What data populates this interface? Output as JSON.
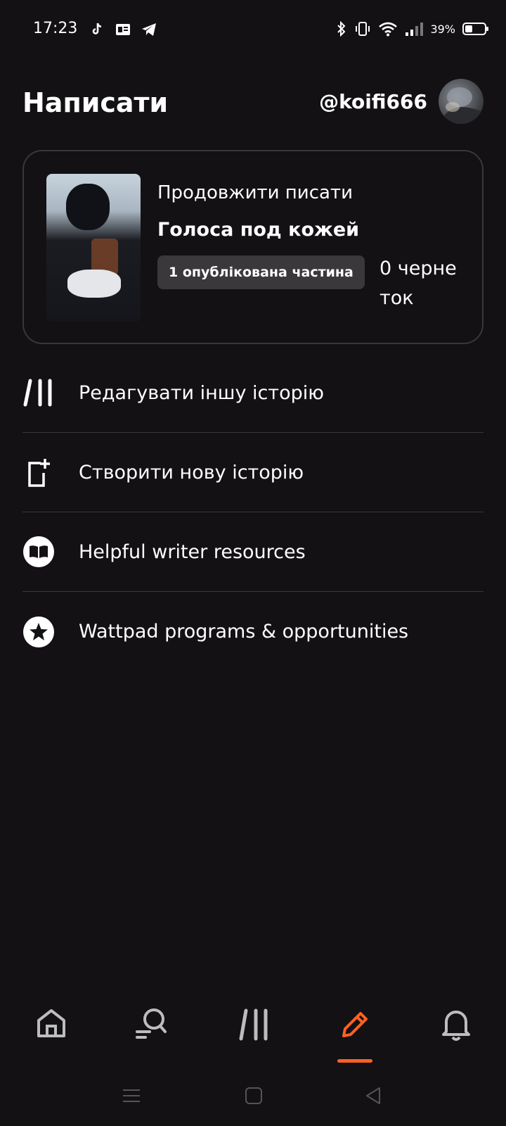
{
  "status_bar": {
    "time": "17:23",
    "battery_percent": "39%",
    "left_icons": [
      "tiktok-icon",
      "news-icon",
      "telegram-icon"
    ],
    "right_icons": [
      "bluetooth-icon",
      "vibrate-icon",
      "wifi-icon",
      "signal-icon",
      "battery-icon"
    ]
  },
  "header": {
    "title": "Написати",
    "username": "@koifi666"
  },
  "continue_card": {
    "subtitle": "Продовжити писати",
    "story_title": "Голоса под кожей",
    "published_badge": "1 опублікована частина",
    "drafts": "0 черне ток"
  },
  "menu": {
    "items": [
      {
        "label": "Редагувати іншу історію",
        "icon": "library-icon"
      },
      {
        "label": "Створити нову історію",
        "icon": "new-story-icon"
      },
      {
        "label": "Helpful writer resources",
        "icon": "book-icon"
      },
      {
        "label": "Wattpad programs & opportunities",
        "icon": "star-icon"
      }
    ]
  },
  "bottom_nav": {
    "items": [
      "home-icon",
      "search-icon",
      "library-icon",
      "write-icon",
      "notifications-icon"
    ],
    "active": "write-icon",
    "active_color": "#ff6122"
  },
  "colors": {
    "background": "#131114",
    "accent": "#ff6122",
    "divider": "#3a373b"
  }
}
